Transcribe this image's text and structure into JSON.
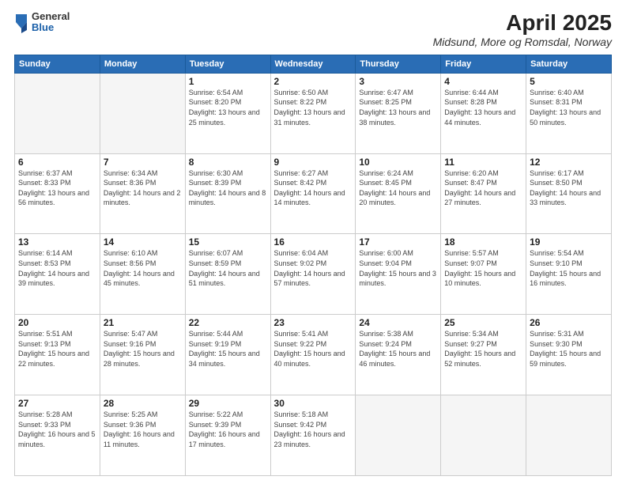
{
  "header": {
    "logo": {
      "general": "General",
      "blue": "Blue"
    },
    "title": "April 2025",
    "subtitle": "Midsund, More og Romsdal, Norway"
  },
  "weekdays": [
    "Sunday",
    "Monday",
    "Tuesday",
    "Wednesday",
    "Thursday",
    "Friday",
    "Saturday"
  ],
  "weeks": [
    [
      {
        "day": "",
        "info": ""
      },
      {
        "day": "",
        "info": ""
      },
      {
        "day": "1",
        "info": "Sunrise: 6:54 AM\nSunset: 8:20 PM\nDaylight: 13 hours\nand 25 minutes."
      },
      {
        "day": "2",
        "info": "Sunrise: 6:50 AM\nSunset: 8:22 PM\nDaylight: 13 hours\nand 31 minutes."
      },
      {
        "day": "3",
        "info": "Sunrise: 6:47 AM\nSunset: 8:25 PM\nDaylight: 13 hours\nand 38 minutes."
      },
      {
        "day": "4",
        "info": "Sunrise: 6:44 AM\nSunset: 8:28 PM\nDaylight: 13 hours\nand 44 minutes."
      },
      {
        "day": "5",
        "info": "Sunrise: 6:40 AM\nSunset: 8:31 PM\nDaylight: 13 hours\nand 50 minutes."
      }
    ],
    [
      {
        "day": "6",
        "info": "Sunrise: 6:37 AM\nSunset: 8:33 PM\nDaylight: 13 hours\nand 56 minutes."
      },
      {
        "day": "7",
        "info": "Sunrise: 6:34 AM\nSunset: 8:36 PM\nDaylight: 14 hours\nand 2 minutes."
      },
      {
        "day": "8",
        "info": "Sunrise: 6:30 AM\nSunset: 8:39 PM\nDaylight: 14 hours\nand 8 minutes."
      },
      {
        "day": "9",
        "info": "Sunrise: 6:27 AM\nSunset: 8:42 PM\nDaylight: 14 hours\nand 14 minutes."
      },
      {
        "day": "10",
        "info": "Sunrise: 6:24 AM\nSunset: 8:45 PM\nDaylight: 14 hours\nand 20 minutes."
      },
      {
        "day": "11",
        "info": "Sunrise: 6:20 AM\nSunset: 8:47 PM\nDaylight: 14 hours\nand 27 minutes."
      },
      {
        "day": "12",
        "info": "Sunrise: 6:17 AM\nSunset: 8:50 PM\nDaylight: 14 hours\nand 33 minutes."
      }
    ],
    [
      {
        "day": "13",
        "info": "Sunrise: 6:14 AM\nSunset: 8:53 PM\nDaylight: 14 hours\nand 39 minutes."
      },
      {
        "day": "14",
        "info": "Sunrise: 6:10 AM\nSunset: 8:56 PM\nDaylight: 14 hours\nand 45 minutes."
      },
      {
        "day": "15",
        "info": "Sunrise: 6:07 AM\nSunset: 8:59 PM\nDaylight: 14 hours\nand 51 minutes."
      },
      {
        "day": "16",
        "info": "Sunrise: 6:04 AM\nSunset: 9:02 PM\nDaylight: 14 hours\nand 57 minutes."
      },
      {
        "day": "17",
        "info": "Sunrise: 6:00 AM\nSunset: 9:04 PM\nDaylight: 15 hours\nand 3 minutes."
      },
      {
        "day": "18",
        "info": "Sunrise: 5:57 AM\nSunset: 9:07 PM\nDaylight: 15 hours\nand 10 minutes."
      },
      {
        "day": "19",
        "info": "Sunrise: 5:54 AM\nSunset: 9:10 PM\nDaylight: 15 hours\nand 16 minutes."
      }
    ],
    [
      {
        "day": "20",
        "info": "Sunrise: 5:51 AM\nSunset: 9:13 PM\nDaylight: 15 hours\nand 22 minutes."
      },
      {
        "day": "21",
        "info": "Sunrise: 5:47 AM\nSunset: 9:16 PM\nDaylight: 15 hours\nand 28 minutes."
      },
      {
        "day": "22",
        "info": "Sunrise: 5:44 AM\nSunset: 9:19 PM\nDaylight: 15 hours\nand 34 minutes."
      },
      {
        "day": "23",
        "info": "Sunrise: 5:41 AM\nSunset: 9:22 PM\nDaylight: 15 hours\nand 40 minutes."
      },
      {
        "day": "24",
        "info": "Sunrise: 5:38 AM\nSunset: 9:24 PM\nDaylight: 15 hours\nand 46 minutes."
      },
      {
        "day": "25",
        "info": "Sunrise: 5:34 AM\nSunset: 9:27 PM\nDaylight: 15 hours\nand 52 minutes."
      },
      {
        "day": "26",
        "info": "Sunrise: 5:31 AM\nSunset: 9:30 PM\nDaylight: 15 hours\nand 59 minutes."
      }
    ],
    [
      {
        "day": "27",
        "info": "Sunrise: 5:28 AM\nSunset: 9:33 PM\nDaylight: 16 hours\nand 5 minutes."
      },
      {
        "day": "28",
        "info": "Sunrise: 5:25 AM\nSunset: 9:36 PM\nDaylight: 16 hours\nand 11 minutes."
      },
      {
        "day": "29",
        "info": "Sunrise: 5:22 AM\nSunset: 9:39 PM\nDaylight: 16 hours\nand 17 minutes."
      },
      {
        "day": "30",
        "info": "Sunrise: 5:18 AM\nSunset: 9:42 PM\nDaylight: 16 hours\nand 23 minutes."
      },
      {
        "day": "",
        "info": ""
      },
      {
        "day": "",
        "info": ""
      },
      {
        "day": "",
        "info": ""
      }
    ]
  ]
}
